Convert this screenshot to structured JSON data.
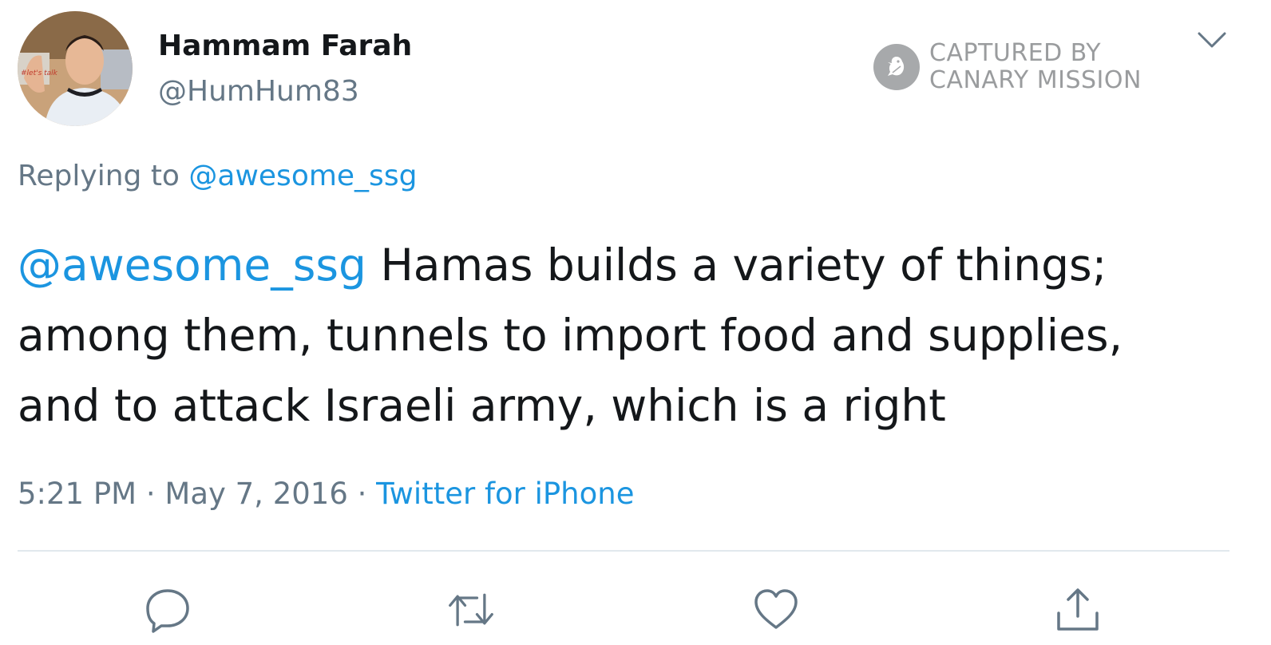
{
  "tweet": {
    "display_name": "Hammam Farah",
    "handle": "@HumHum83",
    "avatar_icon": "profile-photo",
    "reply": {
      "prefix": "Replying to ",
      "mention": "@awesome_ssg"
    },
    "text": {
      "mention": "@awesome_ssg",
      "line1_rest": " Hamas builds a variety of things;",
      "line2": "among them, tunnels to import food and supplies,",
      "line3": "and to attack Israeli army, which is a right"
    },
    "meta": {
      "time": "5:21 PM",
      "separator": " · ",
      "date": "May 7, 2016",
      "source": "Twitter for iPhone"
    },
    "actions": [
      {
        "name": "reply",
        "icon": "speech-bubble-icon"
      },
      {
        "name": "retweet",
        "icon": "retweet-arrows-icon"
      },
      {
        "name": "like",
        "icon": "heart-icon"
      },
      {
        "name": "share",
        "icon": "share-upload-icon"
      }
    ]
  },
  "watermark": {
    "line1": "CAPTURED BY",
    "line2": "CANARY MISSION",
    "icon": "canary-bird-icon"
  },
  "colors": {
    "text": "#14171a",
    "secondary": "#657786",
    "link": "#1b95e0",
    "divider": "#e1e8ed",
    "watermark": "#9a9c9e"
  }
}
